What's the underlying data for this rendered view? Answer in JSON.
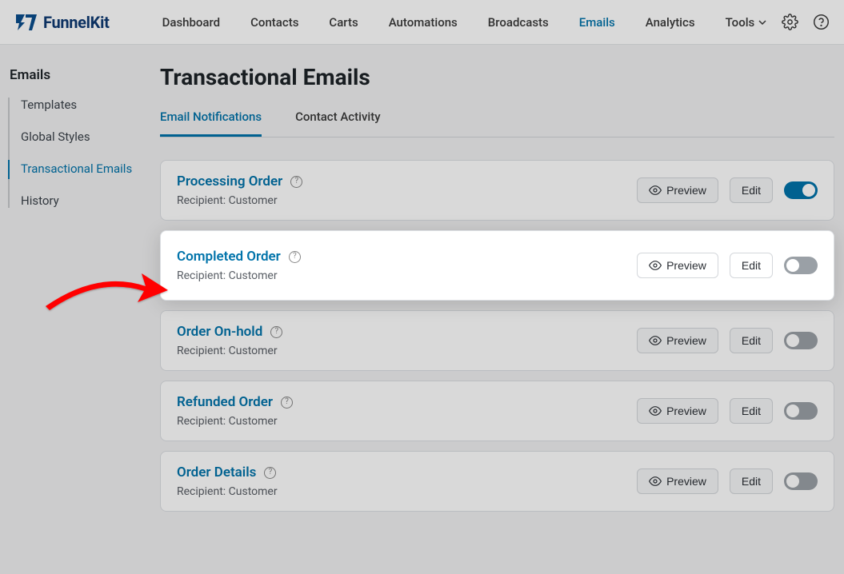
{
  "brand": "FunnelKit",
  "topnav": {
    "items": [
      "Dashboard",
      "Contacts",
      "Carts",
      "Automations",
      "Broadcasts",
      "Emails",
      "Analytics",
      "Tools"
    ],
    "active": "Emails"
  },
  "sidebar": {
    "heading": "Emails",
    "items": [
      "Templates",
      "Global Styles",
      "Transactional Emails",
      "History"
    ],
    "active": "Transactional Emails"
  },
  "page": {
    "title": "Transactional Emails",
    "tabs": [
      "Email Notifications",
      "Contact Activity"
    ],
    "active_tab": "Email Notifications"
  },
  "buttons": {
    "preview": "Preview",
    "edit": "Edit"
  },
  "cards": [
    {
      "title": "Processing Order",
      "subtitle": "Recipient: Customer",
      "enabled": true,
      "highlight": false
    },
    {
      "title": "Completed Order",
      "subtitle": "Recipient: Customer",
      "enabled": false,
      "highlight": true
    },
    {
      "title": "Order On-hold",
      "subtitle": "Recipient: Customer",
      "enabled": false,
      "highlight": false
    },
    {
      "title": "Refunded Order",
      "subtitle": "Recipient: Customer",
      "enabled": false,
      "highlight": false
    },
    {
      "title": "Order Details",
      "subtitle": "Recipient: Customer",
      "enabled": false,
      "highlight": false
    }
  ]
}
